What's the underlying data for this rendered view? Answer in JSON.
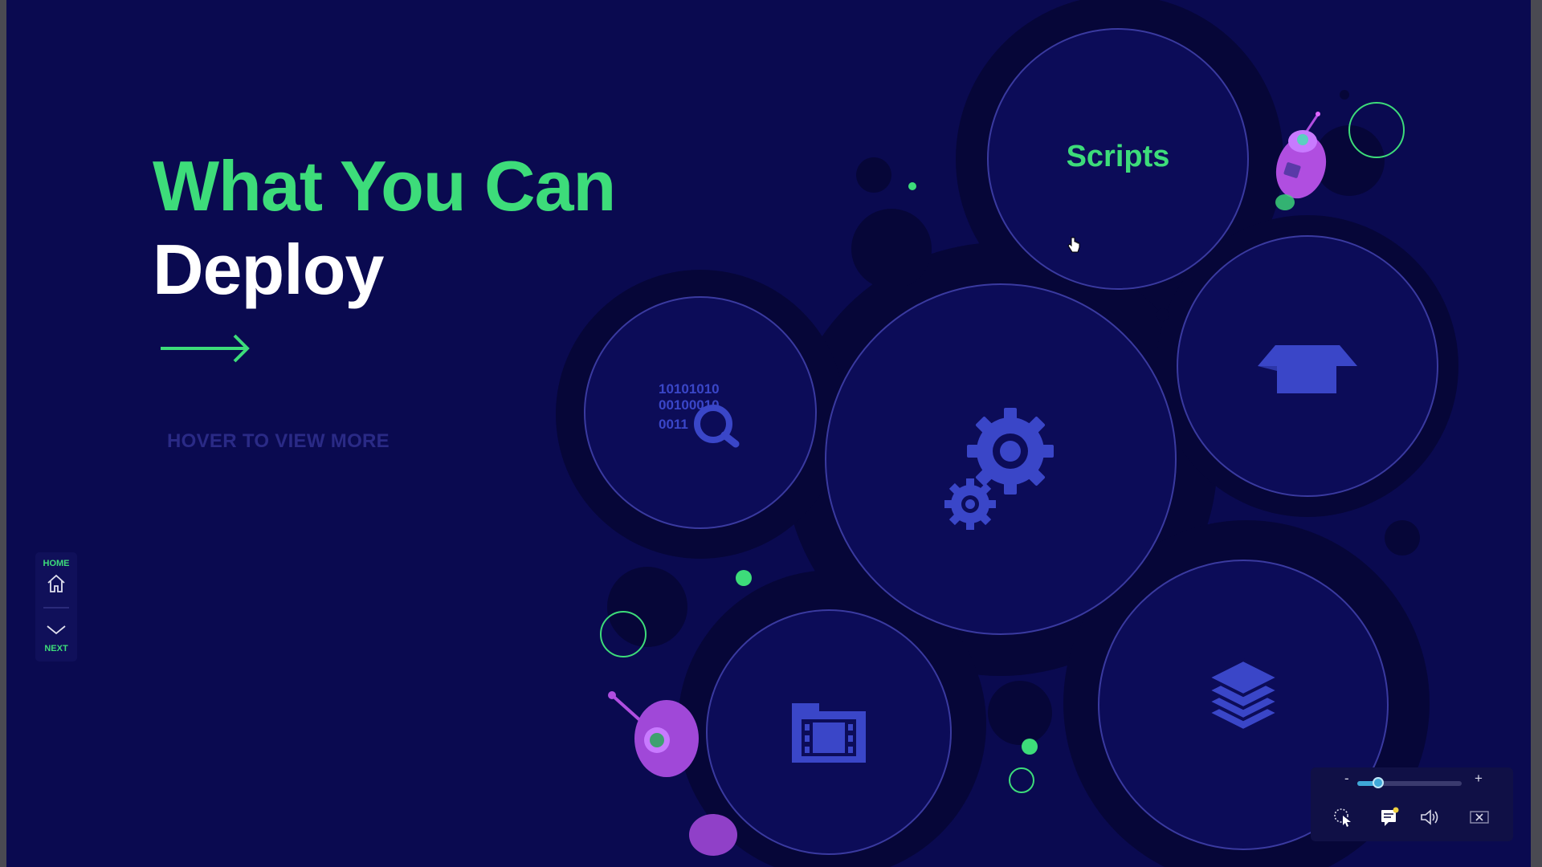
{
  "heading": {
    "line1": "What You Can",
    "line2": "Deploy"
  },
  "hint": "HOVER TO VIEW MORE",
  "bubbles": {
    "scripts_label": "Scripts",
    "icons": [
      "binary-search-icon",
      "gears-icon",
      "box-icon",
      "film-folder-icon",
      "layers-icon",
      "robot-icon"
    ]
  },
  "binary_text": [
    "10101010",
    "00100010",
    "0011"
  ],
  "sidebar_nav": {
    "home_label": "HOME",
    "next_label": "NEXT"
  },
  "player": {
    "zoom_minus": "-",
    "zoom_plus": "+",
    "zoom_level": 0.2
  },
  "colors": {
    "background": "#0a0a50",
    "accent_green": "#3ddc7a",
    "icon_blue": "#3a46c8",
    "ring": "#3a3aa0"
  }
}
